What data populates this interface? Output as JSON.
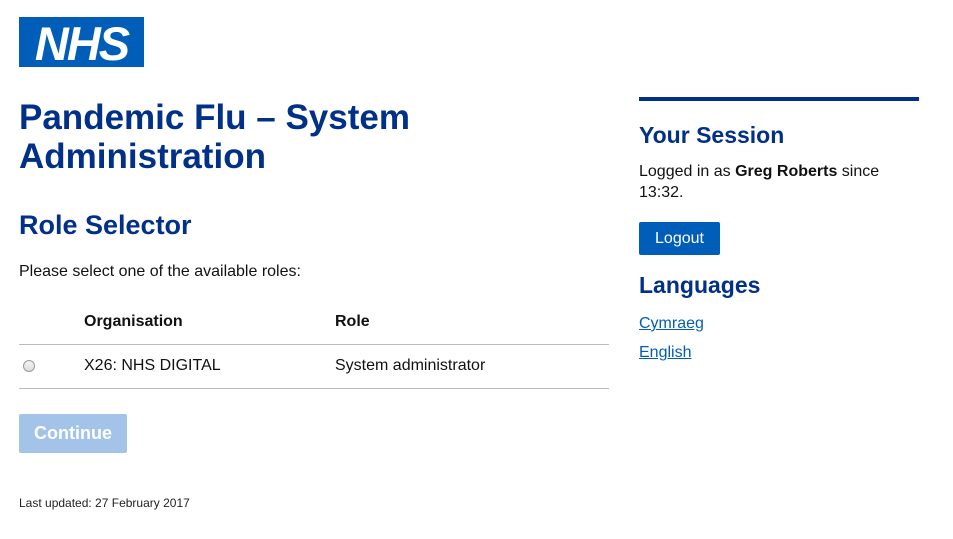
{
  "header": {
    "logo_text": "NHS",
    "logo_color": "#005eb8"
  },
  "main": {
    "page_title": "Pandemic Flu – System Administration",
    "section_title": "Role Selector",
    "instruction": "Please select one of the available roles:",
    "table": {
      "columns": [
        "",
        "Organisation",
        "Role"
      ],
      "rows": [
        {
          "selected": false,
          "organisation": "X26: NHS DIGITAL",
          "role": "System administrator"
        }
      ]
    },
    "continue_label": "Continue",
    "continue_disabled": true,
    "last_updated": "Last updated: 27 February 2017"
  },
  "sidebar": {
    "session_title": "Your Session",
    "session_prefix": "Logged in as",
    "user_name": "Greg Roberts",
    "session_suffix": "since 13:32.",
    "logout_label": "Logout",
    "languages_title": "Languages",
    "languages": [
      "Cymraeg",
      "English"
    ]
  },
  "colors": {
    "heading": "#003087",
    "primary_button": "#005eb8",
    "disabled_button": "#a3c4e8",
    "link": "#005eb8"
  }
}
